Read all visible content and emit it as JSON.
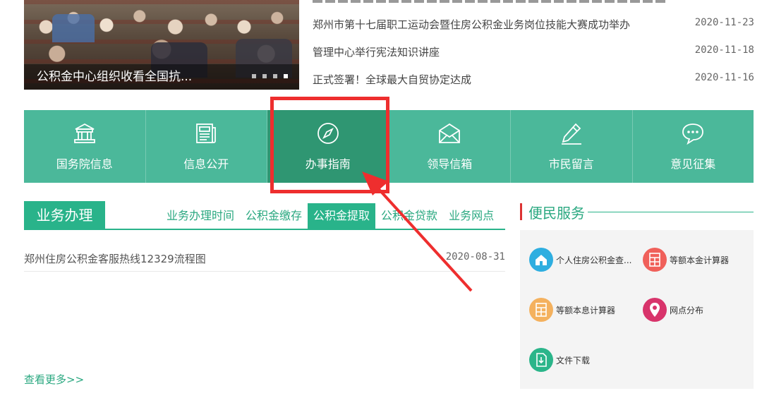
{
  "top_news": {
    "carousel_caption": "公积金中心组织收看全国抗...",
    "items": [
      {
        "title": "郑州市第十七届职工运动会暨住房公积金业务岗位技能大赛成功举办",
        "date": "2020-11-23"
      },
      {
        "title": "管理中心举行宪法知识讲座",
        "date": "2020-11-18"
      },
      {
        "title": "正式签署！全球最大自贸协定达成",
        "date": "2020-11-16"
      }
    ]
  },
  "nav": {
    "items": [
      {
        "label": "国务院信息",
        "icon": "building-icon"
      },
      {
        "label": "信息公开",
        "icon": "newspaper-icon"
      },
      {
        "label": "办事指南",
        "icon": "compass-icon"
      },
      {
        "label": "领导信箱",
        "icon": "envelope-icon"
      },
      {
        "label": "市民留言",
        "icon": "pen-icon"
      },
      {
        "label": "意见征集",
        "icon": "chat-icon"
      }
    ],
    "active_index": 2
  },
  "business": {
    "title": "业务办理",
    "tabs": [
      "业务办理时间",
      "公积金缴存",
      "公积金提取",
      "公积金贷款",
      "业务网点"
    ],
    "active_tab": 2,
    "items": [
      {
        "title": "郑州住房公积金客服热线12329流程图",
        "date": "2020-08-31"
      }
    ],
    "more_label": "查看更多>>"
  },
  "service": {
    "title": "便民服务",
    "items": [
      {
        "label": "个人住房公积金查...",
        "icon": "house-icon",
        "color": "#2eaee0"
      },
      {
        "label": "等额本金计算器",
        "icon": "calculator-icon",
        "color": "#f0605a"
      },
      {
        "label": "等额本息计算器",
        "icon": "calculator-icon",
        "color": "#f4b15e"
      },
      {
        "label": "网点分布",
        "icon": "location-pin-icon",
        "color": "#d8346b"
      },
      {
        "label": "文件下载",
        "icon": "download-icon",
        "color": "#2bb58a"
      }
    ]
  },
  "colors": {
    "nav_bg": "#4bb89a",
    "nav_active": "#2f9672",
    "accent": "#29b38a",
    "annotation": "#ee2e2e"
  }
}
